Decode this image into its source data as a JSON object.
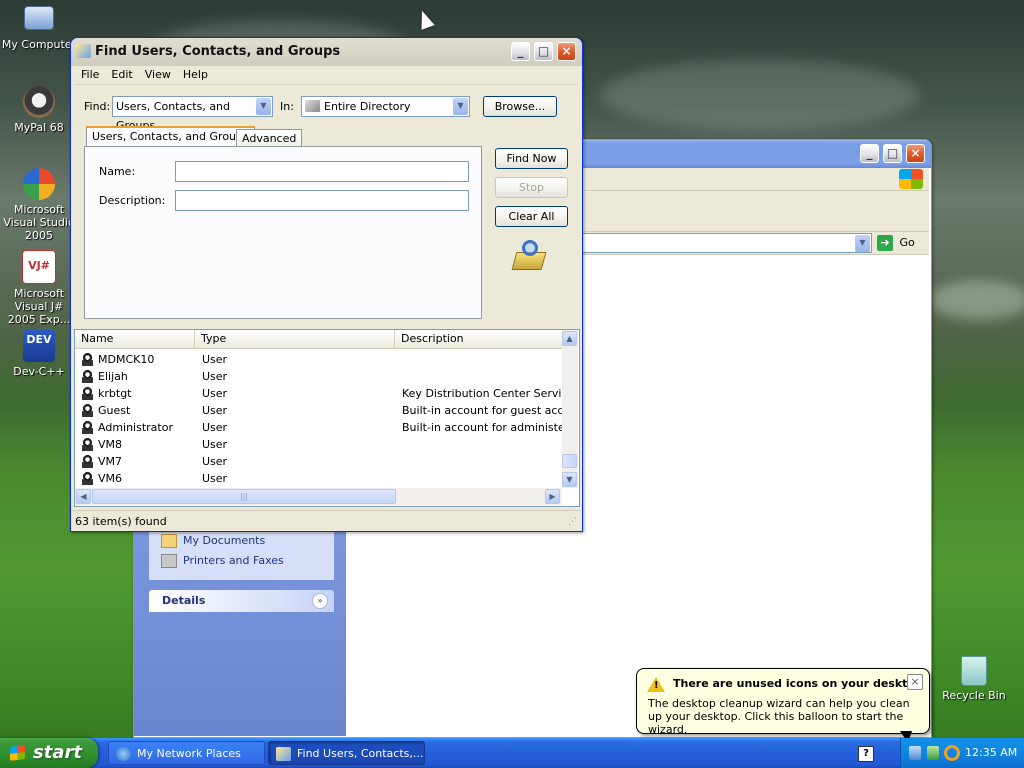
{
  "desktop": {
    "icons": [
      {
        "label": "My Computer"
      },
      {
        "label": "MyPal 68"
      },
      {
        "label": "Microsoft Visual Studio 2005"
      },
      {
        "label": "Microsoft Visual J# 2005 Exp..."
      },
      {
        "label": "Dev-C++"
      },
      {
        "label": "Recycle Bin"
      }
    ]
  },
  "bg_window": {
    "go_label": "Go",
    "sidebar_links": [
      "My Documents",
      "Printers and Faxes"
    ],
    "details_label": "Details"
  },
  "find_window": {
    "title": "Find Users, Contacts, and Groups",
    "menu": [
      "File",
      "Edit",
      "View",
      "Help"
    ],
    "find_label": "Find:",
    "find_value": "Users, Contacts, and Groups",
    "in_label": "In:",
    "in_value": "Entire Directory",
    "browse_label": "Browse...",
    "tabs": [
      "Users, Contacts, and Groups",
      "Advanced"
    ],
    "name_label": "Name:",
    "description_label": "Description:",
    "find_now_label": "Find Now",
    "stop_label": "Stop",
    "clear_all_label": "Clear All",
    "columns": [
      "Name",
      "Type",
      "Description"
    ],
    "rows": [
      {
        "name": "MDMCK10",
        "type": "User",
        "description": ""
      },
      {
        "name": "Elijah",
        "type": "User",
        "description": ""
      },
      {
        "name": "krbtgt",
        "type": "User",
        "description": "Key Distribution Center Service A"
      },
      {
        "name": "Guest",
        "type": "User",
        "description": "Built-in account for guest access t"
      },
      {
        "name": "Administrator",
        "type": "User",
        "description": "Built-in account for administering"
      },
      {
        "name": "VM8",
        "type": "User",
        "description": ""
      },
      {
        "name": "VM7",
        "type": "User",
        "description": ""
      },
      {
        "name": "VM6",
        "type": "User",
        "description": ""
      }
    ],
    "status": "63 item(s) found"
  },
  "balloon": {
    "title": "There are unused icons on your desktop",
    "body": "The desktop cleanup wizard can help you clean up your desktop. Click this balloon to start the wizard."
  },
  "taskbar": {
    "start_label": "start",
    "tasks": [
      "My Network Places",
      "Find Users, Contacts,..."
    ],
    "clock": "12:35 AM"
  },
  "colors": {
    "taskbar_blue": "#245edb",
    "start_green": "#3c9a39",
    "title_active": "#0831d9"
  }
}
